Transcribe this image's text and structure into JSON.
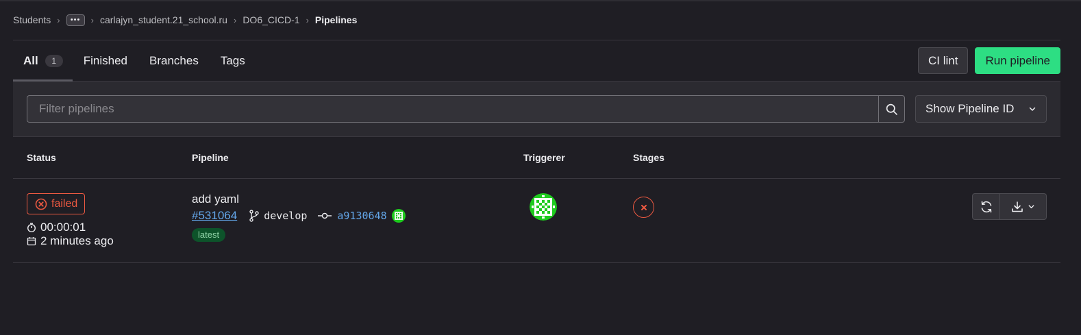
{
  "breadcrumb": {
    "items": [
      "Students",
      "carlajyn_student.21_school.ru",
      "DO6_CICD-1"
    ],
    "more": "•••",
    "current": "Pipelines"
  },
  "tabs": [
    {
      "label": "All",
      "count": "1",
      "active": true
    },
    {
      "label": "Finished"
    },
    {
      "label": "Branches"
    },
    {
      "label": "Tags"
    }
  ],
  "toolbar": {
    "ci_lint_label": "CI lint",
    "run_pipeline_label": "Run pipeline"
  },
  "filter": {
    "placeholder": "Filter pipelines",
    "select_value": "Show Pipeline ID"
  },
  "table": {
    "headers": [
      "Status",
      "Pipeline",
      "Triggerer",
      "Stages"
    ],
    "rows": [
      {
        "status": "failed",
        "duration": "00:00:01",
        "finished": "2 minutes ago",
        "title": "add yaml",
        "pipeline_id": "#531064",
        "branch": "develop",
        "commit_sha": "a9130648",
        "tag": "latest",
        "stage_status": "failed"
      }
    ]
  },
  "colors": {
    "background": "#1f1e24",
    "primary_button": "#2dde83",
    "failed": "#ec5941",
    "link": "#63a6e9",
    "avatar": "#1ecb1e"
  },
  "icons": [
    "chevron-right-icon",
    "search-icon",
    "chevron-down-icon",
    "status-failed-icon",
    "timer-icon",
    "calendar-icon",
    "branch-icon",
    "commit-icon",
    "retry-icon",
    "download-icon"
  ]
}
